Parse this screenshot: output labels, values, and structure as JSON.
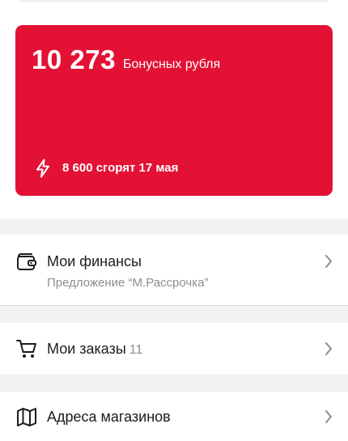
{
  "bonus": {
    "amount": "10 273",
    "label": "Бонусных рубля",
    "expiry_text": "8 600 сгорят 17 мая",
    "card_color": "#e31235",
    "expiry_icon": "lightning-bolt-icon"
  },
  "menu": {
    "finances": {
      "title": "Мои финансы",
      "subtitle": "Предложение “М.Рассрочка”",
      "icon": "wallet-icon"
    },
    "orders": {
      "title": "Мои заказы",
      "count": "11",
      "icon": "cart-icon"
    },
    "stores": {
      "title": "Адреса магазинов",
      "icon": "map-icon"
    },
    "chevron_icon": "chevron-right-icon"
  }
}
